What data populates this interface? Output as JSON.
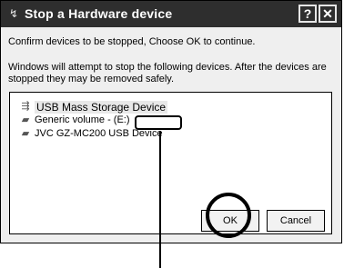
{
  "window": {
    "title": "Stop a Hardware device",
    "help_glyph": "?",
    "close_glyph": "✕"
  },
  "messages": {
    "line1": "Confirm devices to be stopped, Choose OK to continue.",
    "line2": "Windows will attempt to stop the following devices. After the devices are stopped they may be removed safely."
  },
  "devices": [
    {
      "label": "USB Mass Storage Device",
      "icon": "usb-icon",
      "selected": true
    },
    {
      "label": "Generic volume - (E:)",
      "icon": "drive-icon",
      "selected": false
    },
    {
      "label": "JVC GZ-MC200 USB Device",
      "icon": "drive-icon",
      "selected": false
    }
  ],
  "buttons": {
    "ok": "OK",
    "cancel": "Cancel"
  }
}
